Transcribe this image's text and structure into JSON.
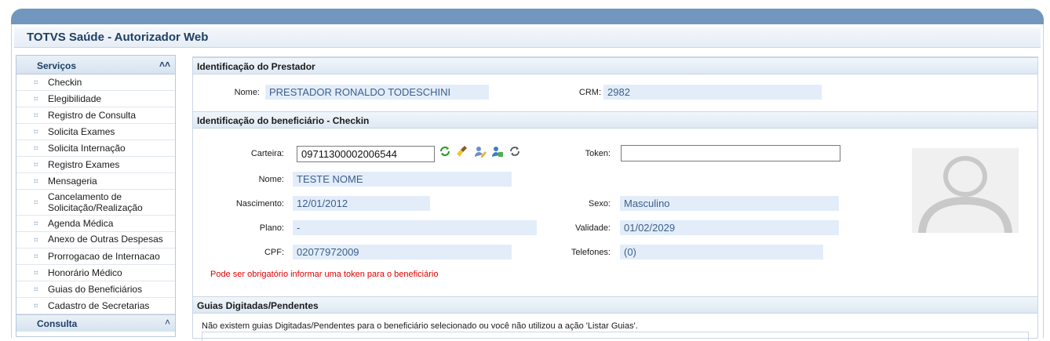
{
  "app": {
    "title": "TOTVS Saúde - Autorizador Web"
  },
  "sidebar": {
    "section_title": "Serviços",
    "items": [
      {
        "label": "Checkin"
      },
      {
        "label": "Elegibilidade"
      },
      {
        "label": "Registro de Consulta"
      },
      {
        "label": "Solicita Exames"
      },
      {
        "label": "Solicita Internação"
      },
      {
        "label": "Registro Exames"
      },
      {
        "label": "Mensageria"
      },
      {
        "label": "Cancelamento de Solicitação/Realização"
      },
      {
        "label": "Agenda Médica"
      },
      {
        "label": "Anexo de Outras Despesas"
      },
      {
        "label": "Prorrogacao de Internacao"
      },
      {
        "label": "Honorário Médico"
      },
      {
        "label": "Guias do Beneficiários"
      },
      {
        "label": "Cadastro de Secretarias"
      }
    ],
    "section2_title": "Consulta"
  },
  "prestador": {
    "section_title": "Identificação do Prestador",
    "nome_label": "Nome:",
    "nome_value": "PRESTADOR RONALDO TODESCHINI",
    "crm_label": "CRM:",
    "crm_value": "2982"
  },
  "beneficiario": {
    "section_title": "Identificação do beneficiário - Checkin",
    "carteira_label": "Carteira:",
    "carteira_value": "09711300002006544",
    "token_label": "Token:",
    "token_value": "",
    "nome_label": "Nome:",
    "nome_value": "TESTE NOME",
    "nascimento_label": "Nascimento:",
    "nascimento_value": "12/01/2012",
    "sexo_label": "Sexo:",
    "sexo_value": "Masculino",
    "plano_label": "Plano:",
    "plano_value": "-",
    "validade_label": "Validade:",
    "validade_value": "01/02/2029",
    "cpf_label": "CPF:",
    "cpf_value": "02077972009",
    "telefones_label": "Telefones:",
    "telefones_value": "(0)",
    "warning": "Pode ser obrigatório informar uma token para o beneficiário"
  },
  "guias": {
    "section_title": "Guias Digitadas/Pendentes",
    "message": "Não existem guias Digitadas/Pendentes para o beneficiário selecionado ou você não utilizou a ação 'Listar Guias'."
  },
  "icons": [
    "refresh-green-icon",
    "clear-broom-icon",
    "edit-user-icon",
    "user-search-icon",
    "reload-icon"
  ],
  "colors": {
    "accent": "#7197bf",
    "value_bg": "#e3edf9",
    "value_text": "#3c5f8c",
    "warning": "#e00000",
    "title": "#1f3f66"
  }
}
